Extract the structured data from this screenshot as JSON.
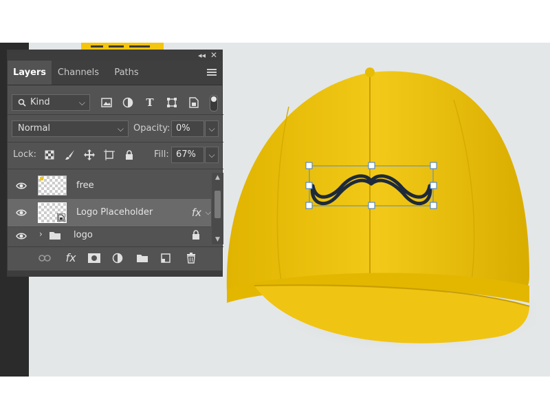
{
  "panel": {
    "tabs": [
      {
        "label": "Layers",
        "active": true
      },
      {
        "label": "Channels",
        "active": false
      },
      {
        "label": "Paths",
        "active": false
      }
    ],
    "filter": {
      "label": "Kind"
    },
    "blend_mode": "Normal",
    "opacity_label": "Opacity:",
    "opacity_value": "0%",
    "lock_label": "Lock:",
    "fill_label": "Fill:",
    "fill_value": "67%",
    "layers": [
      {
        "name": "free",
        "visible": true,
        "selected": false
      },
      {
        "name": "Logo Placeholder",
        "visible": true,
        "selected": true,
        "fx": "fx"
      },
      {
        "name": "logo",
        "visible": true,
        "selected": false,
        "type": "group",
        "locked": true
      }
    ],
    "fx_label": "fx"
  },
  "icons": {
    "filter_icons": [
      "image-icon",
      "adjustment-icon",
      "type-icon",
      "shape-icon",
      "smart-object-icon",
      "toggle-icon"
    ],
    "lock_icons": [
      "lock-transparent-icon",
      "lock-brush-icon",
      "lock-move-icon",
      "lock-artboard-icon",
      "lock-all-icon"
    ],
    "bottom_icons": [
      "link-icon",
      "fx-icon",
      "mask-icon",
      "adjustment-layer-icon",
      "folder-icon",
      "new-layer-icon",
      "trash-icon"
    ]
  },
  "colors": {
    "cap": "#f1c40f",
    "panel_bg": "#535353",
    "selection_handle": "#3b7dd8"
  }
}
